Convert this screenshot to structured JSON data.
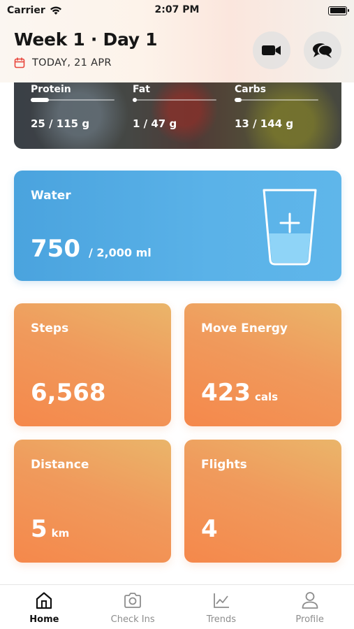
{
  "status_bar": {
    "carrier": "Carrier",
    "time": "2:07 PM"
  },
  "header": {
    "title": "Week 1 · Day 1",
    "date": "TODAY, 21 APR",
    "icons": [
      "calendar-icon",
      "video-camera-icon",
      "chat-bubbles-icon"
    ]
  },
  "macros": [
    {
      "label": "Protein",
      "value": "25 / 115 g",
      "progress": 0.22
    },
    {
      "label": "Fat",
      "value": "1 / 47 g",
      "progress": 0.02
    },
    {
      "label": "Carbs",
      "value": "13 / 144 g",
      "progress": 0.09
    }
  ],
  "water": {
    "label": "Water",
    "value": "750",
    "goal": "/  2,000 ml",
    "fill_fraction": 0.375,
    "icon": "water-glass-plus-icon"
  },
  "metrics": {
    "steps": {
      "label": "Steps",
      "value": "6,568",
      "unit": ""
    },
    "move_energy": {
      "label": "Move Energy",
      "value": "423",
      "unit": "cals"
    },
    "distance": {
      "label": "Distance",
      "value": "5",
      "unit": "km"
    },
    "flights": {
      "label": "Flights",
      "value": "4",
      "unit": ""
    }
  },
  "tabs": [
    {
      "label": "Home",
      "icon": "home-icon",
      "active": true
    },
    {
      "label": "Check Ins",
      "icon": "camera-icon",
      "active": false
    },
    {
      "label": "Trends",
      "icon": "chart-icon",
      "active": false
    },
    {
      "label": "Profile",
      "icon": "person-icon",
      "active": false
    }
  ],
  "colors": {
    "water_card": "#4aa3de",
    "metric_card": "#f5884b",
    "accent_red": "#e8463c"
  }
}
